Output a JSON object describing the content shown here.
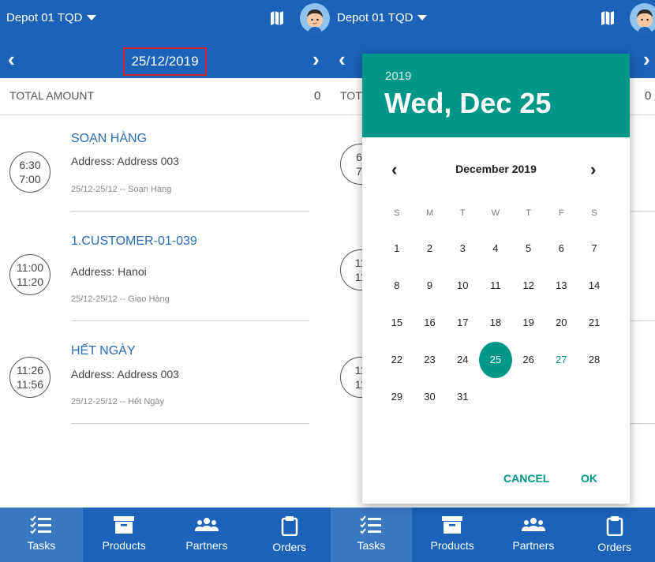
{
  "left": {
    "depot": "Depot 01 TQD",
    "date": "25/12/2019",
    "total_label": "TOTAL AMOUNT",
    "total_value": "0",
    "tasks": [
      {
        "time_start": "6:30",
        "time_end": "7:00",
        "name": "SOẠN HÀNG",
        "address": "Address: Address 003",
        "meta": "25/12-25/12 -- Soạn Hàng"
      },
      {
        "time_start": "11:00",
        "time_end": "11:20",
        "name": "1.CUSTOMER-01-039",
        "address": "Address: Hanoi",
        "meta": "25/12-25/12 -- Giao Hàng"
      },
      {
        "time_start": "11:26",
        "time_end": "11:56",
        "name": "HẾT NGÀY",
        "address": "Address: Address 003",
        "meta": "25/12-25/12 -- Hết Ngày"
      }
    ]
  },
  "right": {
    "depot": "Depot 01 TQD",
    "total_label_partial": "TOT",
    "total_value": "0",
    "bg_clock_fragments": [
      "6:",
      "7:",
      "11",
      "11",
      "11",
      "11"
    ]
  },
  "nav": [
    {
      "label": "Tasks",
      "icon": "tasks-icon",
      "active": true
    },
    {
      "label": "Products",
      "icon": "box-icon",
      "active": false
    },
    {
      "label": "Partners",
      "icon": "people-icon",
      "active": false
    },
    {
      "label": "Orders",
      "icon": "clipboard-icon",
      "active": false
    }
  ],
  "datepicker": {
    "year": "2019",
    "selected_label": "Wed, Dec 25",
    "month_label": "December 2019",
    "weekdays": [
      "S",
      "M",
      "T",
      "W",
      "T",
      "F",
      "S"
    ],
    "weeks": [
      [
        "1",
        "2",
        "3",
        "4",
        "5",
        "6",
        "7"
      ],
      [
        "8",
        "9",
        "10",
        "11",
        "12",
        "13",
        "14"
      ],
      [
        "15",
        "16",
        "17",
        "18",
        "19",
        "20",
        "21"
      ],
      [
        "22",
        "23",
        "24",
        "25",
        "26",
        "27",
        "28"
      ],
      [
        "29",
        "30",
        "31",
        "",
        "",
        "",
        ""
      ]
    ],
    "selected_day": "25",
    "today_day": "27",
    "cancel_label": "CANCEL",
    "ok_label": "OK"
  },
  "colors": {
    "primary": "#1a63b8",
    "accent": "#009688",
    "date_highlight_border": "#d0202a",
    "task_title": "#2a6bb5"
  }
}
